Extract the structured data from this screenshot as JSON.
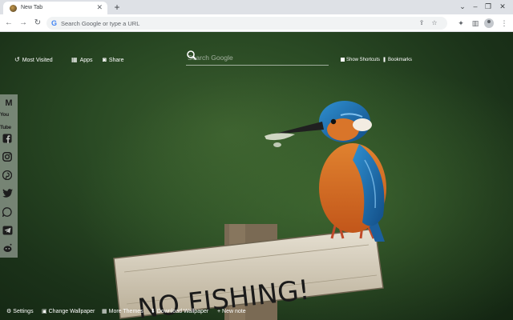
{
  "browser": {
    "tab_title": "New Tab",
    "omnibox_placeholder": "Search Google or type a URL"
  },
  "newtab": {
    "most_visited": "Most Visited",
    "apps": "Apps",
    "share": "Share",
    "search_placeholder": "Search Google",
    "show_shortcuts": "Show Shortcuts",
    "bookmarks": "Bookmarks"
  },
  "sidebar": {
    "items": [
      {
        "name": "gmail",
        "icon": "gmail-icon"
      },
      {
        "name": "youtube",
        "icon": "youtube-icon",
        "label": "You Tube"
      },
      {
        "name": "facebook",
        "icon": "facebook-icon"
      },
      {
        "name": "instagram",
        "icon": "instagram-icon"
      },
      {
        "name": "pinterest",
        "icon": "pinterest-icon"
      },
      {
        "name": "twitter",
        "icon": "twitter-icon"
      },
      {
        "name": "whatsapp",
        "icon": "whatsapp-icon"
      },
      {
        "name": "telegram",
        "icon": "telegram-icon"
      },
      {
        "name": "reddit",
        "icon": "reddit-icon"
      }
    ]
  },
  "footer": {
    "settings": "Settings",
    "change_wallpaper": "Change Wallpaper",
    "more_themes": "More Themes",
    "download_wallpaper": "Download Wallpaper",
    "new_note": "+ New note"
  },
  "wallpaper": {
    "sign_text": "NO FISHING!"
  },
  "colors": {
    "chrome_bg": "#dee1e6",
    "wallpaper_dark": "#1b3219",
    "bird_orange": "#d46a1c",
    "bird_blue": "#1f6fb0"
  }
}
